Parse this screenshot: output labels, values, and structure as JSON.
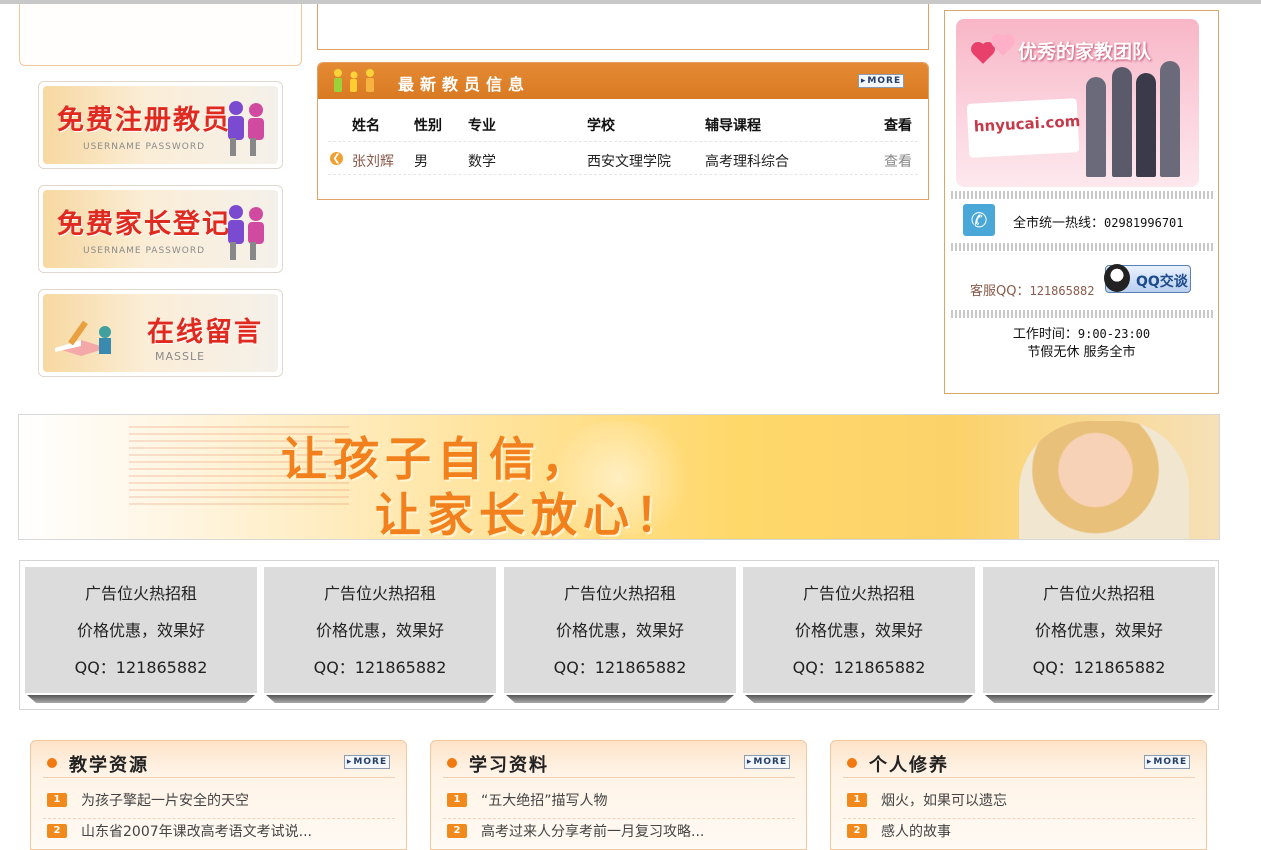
{
  "left": {
    "buttons": [
      {
        "title": "免费注册教员",
        "sub": "USERNAME  PASSWORD"
      },
      {
        "title": "免费家长登记",
        "sub": "USERNAME  PASSWORD"
      },
      {
        "title": "在线留言",
        "sub": "MASSLE"
      }
    ]
  },
  "teachers": {
    "title": "最新教员信息",
    "more": "MORE",
    "columns": [
      "姓名",
      "性别",
      "专业",
      "学校",
      "辅导课程",
      "查看"
    ],
    "rows": [
      {
        "name": "张刘辉",
        "gender": "男",
        "major": "数学",
        "school": "西安文理学院",
        "course": "高考理科综合",
        "view": "查看"
      }
    ]
  },
  "contact": {
    "team_title": "优秀的家教团队",
    "site": "hnyucai.com",
    "hotline_label": "全市统一热线：",
    "hotline": "02981996701",
    "qq_label": "客服QQ：",
    "qq": "121865882",
    "qq_button": "QQ交谈",
    "worktime_label": "工作时间：",
    "worktime": "9:00-23:00",
    "holiday": "节假无休  服务全市"
  },
  "banner": {
    "line1": "让孩子自信，",
    "line2": "让家长放心！"
  },
  "ads": [
    {
      "l1": "广告位火热招租",
      "l2": "价格优惠，效果好",
      "l3": "QQ：121865882"
    },
    {
      "l1": "广告位火热招租",
      "l2": "价格优惠，效果好",
      "l3": "QQ：121865882"
    },
    {
      "l1": "广告位火热招租",
      "l2": "价格优惠，效果好",
      "l3": "QQ：121865882"
    },
    {
      "l1": "广告位火热招租",
      "l2": "价格优惠，效果好",
      "l3": "QQ：121865882"
    },
    {
      "l1": "广告位火热招租",
      "l2": "价格优惠，效果好",
      "l3": "QQ：121865882"
    }
  ],
  "panels": [
    {
      "title": "教学资源",
      "more": "MORE",
      "items": [
        {
          "n": "1",
          "text": "为孩子擎起一片安全的天空"
        },
        {
          "n": "2",
          "text": "山东省2007年课改高考语文考试说..."
        }
      ]
    },
    {
      "title": "学习资料",
      "more": "MORE",
      "items": [
        {
          "n": "1",
          "text": "“五大绝招”描写人物"
        },
        {
          "n": "2",
          "text": "高考过来人分享考前一月复习攻略..."
        }
      ]
    },
    {
      "title": "个人修养",
      "more": "MORE",
      "items": [
        {
          "n": "1",
          "text": "烟火，如果可以遗忘"
        },
        {
          "n": "2",
          "text": "感人的故事"
        }
      ]
    }
  ],
  "colors": {
    "accent": "#e08a34",
    "panel_border": "#e4a064",
    "ad_bg": "#dcdcdc"
  }
}
